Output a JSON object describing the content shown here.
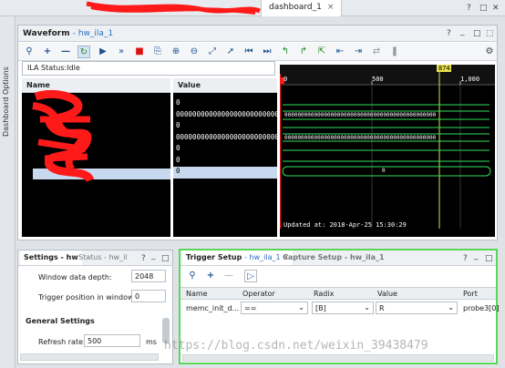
{
  "top": {
    "tab_label": "dashboard_1",
    "close": "×",
    "window_controls": [
      "?",
      "□",
      "✕"
    ]
  },
  "sidebar": {
    "label": "Dashboard Options"
  },
  "waveform": {
    "title": "Waveform",
    "subtitle": "- hw_ila_1",
    "controls": [
      "?",
      "_",
      "□",
      "⬚"
    ],
    "status": "ILA Status:Idle",
    "name_header": "Name",
    "value_header": "Value",
    "values": [
      "0",
      "0000000000000000000000000000",
      "0",
      "0000000000000000000000000000",
      "0",
      "0",
      "0"
    ],
    "bus_values": [
      "0000000000000000000000000000000000000000000000",
      "0000000000000000000000000000000000000000000000"
    ],
    "ruler_labels": [
      "0",
      "500",
      "1,000"
    ],
    "cursor_label": "874",
    "marker_label": "0",
    "updated": "Updated at: 2018-Apr-25 15:30:29",
    "selected_value": "0"
  },
  "settings": {
    "tab_active": "Settings - hw",
    "tab_inactive": "Status - hw_il",
    "controls": [
      "?",
      "_",
      "□"
    ],
    "window_depth_label": "Window data depth:",
    "window_depth_value": "2048",
    "trigger_pos_label": "Trigger position in window:",
    "trigger_pos_value": "0",
    "general_header": "General Settings",
    "refresh_label": "Refresh rate:",
    "refresh_value": "500",
    "refresh_unit": "ms"
  },
  "trigger": {
    "tab_active": "Trigger Setup",
    "tab_active_sub": "- hw_ila_1",
    "tab_close": "✕",
    "tab_inactive": "Capture Setup - hw_ila_1",
    "controls": [
      "?",
      "_",
      "□"
    ],
    "columns": [
      "Name",
      "Operator",
      "Radix",
      "Value",
      "Port"
    ],
    "row": {
      "name": "memc_init_d...",
      "operator": "==",
      "radix": "[B]",
      "value": "R",
      "port": "probe3[0]"
    }
  },
  "watermark": "https://blog.csdn.net/weixin_39438479",
  "colors": {
    "accent": "#2a6cc2",
    "wave_green": "#2fe05a",
    "cursor_yellow": "#e6e04a",
    "trigger_border": "#5ad65a",
    "redaction": "#ff1a1a"
  }
}
